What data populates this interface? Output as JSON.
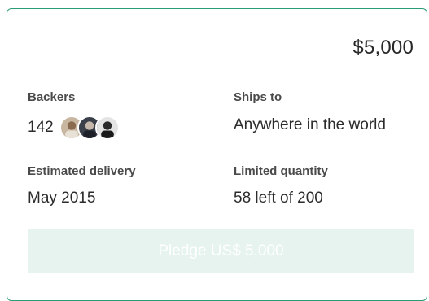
{
  "reward": {
    "price": "$5,000",
    "backers_label": "Backers",
    "backers_count": "142",
    "backer_avatars": [
      {
        "icon": "backer-avatar-1"
      },
      {
        "icon": "backer-avatar-2"
      },
      {
        "icon": "backer-avatar-3"
      }
    ],
    "ships_to_label": "Ships to",
    "ships_to_value": "Anywhere in the world",
    "delivery_label": "Estimated delivery",
    "delivery_value": "May 2015",
    "quantity_label": "Limited quantity",
    "quantity_value": "58 left of 200",
    "pledge_button_label": "Pledge US$ 5,000"
  },
  "colors": {
    "border": "#2b9c78",
    "button_bg": "#e6f3ef",
    "button_text": "#ffffff",
    "text": "#2b2b2b"
  }
}
